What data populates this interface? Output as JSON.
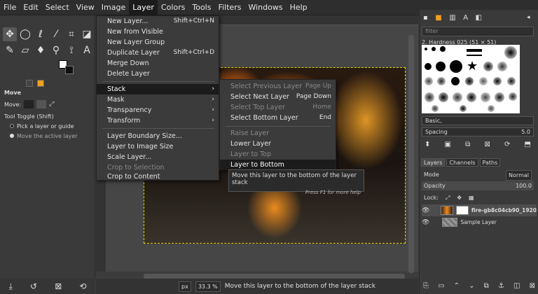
{
  "menubar": {
    "items": [
      "File",
      "Edit",
      "Select",
      "View",
      "Image",
      "Layer",
      "Colors",
      "Tools",
      "Filters",
      "Windows",
      "Help"
    ],
    "active": "Layer"
  },
  "tool_options": {
    "title": "Move",
    "move_label": "Move:",
    "toggle_label": "Tool Toggle  (Shift)",
    "option1": "Pick a layer or guide",
    "option2": "Move the active layer"
  },
  "layer_menu": {
    "items": [
      {
        "label": "New Layer...",
        "shortcut": "Shift+Ctrl+N"
      },
      {
        "label": "New from Visible",
        "shortcut": ""
      },
      {
        "label": "New Layer Group",
        "shortcut": ""
      },
      {
        "label": "Duplicate Layer",
        "shortcut": "Shift+Ctrl+D"
      },
      {
        "label": "Merge Down",
        "shortcut": ""
      },
      {
        "label": "Delete Layer",
        "shortcut": ""
      },
      {
        "label": "Stack",
        "shortcut": ""
      },
      {
        "label": "Mask",
        "shortcut": ""
      },
      {
        "label": "Transparency",
        "shortcut": ""
      },
      {
        "label": "Transform",
        "shortcut": ""
      },
      {
        "label": "Layer Boundary Size...",
        "shortcut": ""
      },
      {
        "label": "Layer to Image Size",
        "shortcut": ""
      },
      {
        "label": "Scale Layer...",
        "shortcut": ""
      },
      {
        "label": "Crop to Selection",
        "shortcut": ""
      },
      {
        "label": "Crop to Content",
        "shortcut": ""
      }
    ]
  },
  "stack_menu": {
    "items": [
      {
        "label": "Select Previous Layer",
        "shortcut": "Page Up"
      },
      {
        "label": "Select Next Layer",
        "shortcut": "Page Down"
      },
      {
        "label": "Select Top Layer",
        "shortcut": "Home"
      },
      {
        "label": "Select Bottom Layer",
        "shortcut": "End"
      },
      {
        "label": "Raise Layer",
        "shortcut": ""
      },
      {
        "label": "Lower Layer",
        "shortcut": ""
      },
      {
        "label": "Layer to Top",
        "shortcut": ""
      },
      {
        "label": "Layer to Bottom",
        "shortcut": ""
      }
    ]
  },
  "tooltip": {
    "text": "Move this layer to the bottom of the layer stack",
    "hint": "Press F1 for more help"
  },
  "status": {
    "unit": "px",
    "zoom": "33.3 %",
    "message": "Move this layer to the bottom of the layer stack"
  },
  "brushes": {
    "filter_placeholder": "filter",
    "title": "2. Hardness 025 (51 × 51)",
    "preset": "Basic,",
    "spacing_label": "Spacing",
    "spacing_value": "5.0"
  },
  "layers": {
    "tabs": [
      "Layers",
      "Channels",
      "Paths"
    ],
    "mode_label": "Mode",
    "mode_value": "Normal",
    "opacity_label": "Opacity",
    "opacity_value": "100.0",
    "lock_label": "Lock:",
    "rows": [
      {
        "name": "fire-gb8c04cb90_1920"
      },
      {
        "name": "Sample Layer"
      }
    ]
  },
  "colors": {
    "accent": "#f0a020",
    "menu_bg": "#3b3b3b",
    "highlight": "#1c1c1c"
  }
}
